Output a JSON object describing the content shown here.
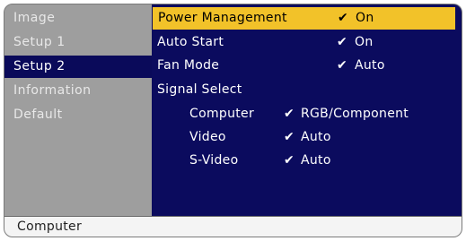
{
  "sidebar": {
    "items": [
      {
        "label": "Image"
      },
      {
        "label": "Setup 1"
      },
      {
        "label": "Setup 2"
      },
      {
        "label": "Information"
      },
      {
        "label": "Default"
      }
    ]
  },
  "main": {
    "rows": [
      {
        "label": "Power Management",
        "check": "✔",
        "value": "On"
      },
      {
        "label": "Auto Start",
        "check": "✔",
        "value": "On"
      },
      {
        "label": "Fan Mode",
        "check": "✔",
        "value": "Auto"
      },
      {
        "label": "Signal Select"
      },
      {
        "label": "Computer",
        "check": "✔",
        "value": "RGB/Component"
      },
      {
        "label": "Video",
        "check": "✔",
        "value": "Auto"
      },
      {
        "label": "S-Video",
        "check": "✔",
        "value": "Auto"
      }
    ]
  },
  "status": {
    "text": "Computer"
  },
  "colors": {
    "panel_bg": "#0b0b5e",
    "sidebar_bg": "#9e9e9e",
    "highlight": "#f2c229",
    "status_bg": "#f4f4f4"
  }
}
